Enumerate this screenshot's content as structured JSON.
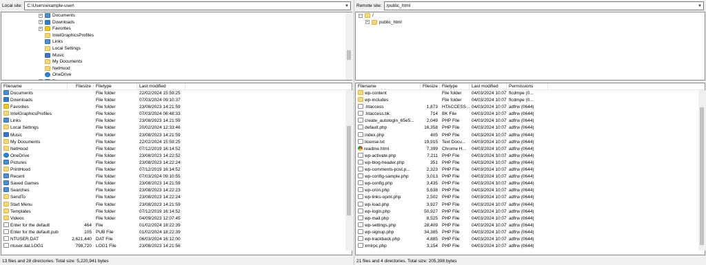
{
  "local": {
    "site_label": "Local site:",
    "path": "C:\\Users\\example-user\\",
    "tree": [
      {
        "label": "Documents",
        "indent": 1,
        "icon": "special",
        "exp": "+"
      },
      {
        "label": "Downloads",
        "indent": 1,
        "icon": "download",
        "exp": "+"
      },
      {
        "label": "Favorites",
        "indent": 1,
        "icon": "star",
        "exp": "+"
      },
      {
        "label": "IntelGraphicsProfiles",
        "indent": 1,
        "icon": "folder",
        "exp": ""
      },
      {
        "label": "Links",
        "indent": 1,
        "icon": "special",
        "exp": ""
      },
      {
        "label": "Local Settings",
        "indent": 1,
        "icon": "folder",
        "exp": ""
      },
      {
        "label": "Music",
        "indent": 1,
        "icon": "music",
        "exp": ""
      },
      {
        "label": "My Documents",
        "indent": 1,
        "icon": "folder",
        "exp": ""
      },
      {
        "label": "NetHood",
        "indent": 1,
        "icon": "folder",
        "exp": ""
      },
      {
        "label": "OneDrive",
        "indent": 1,
        "icon": "cloud",
        "exp": ""
      },
      {
        "label": "Pictures",
        "indent": 1,
        "icon": "special",
        "exp": "+"
      }
    ],
    "columns": [
      "Filename",
      "Filesize",
      "Filetype",
      "Last modified"
    ],
    "files": [
      {
        "name": "Documents",
        "size": "",
        "type": "File folder",
        "date": "22/02/2024 15:59:25",
        "icon": "special"
      },
      {
        "name": "Downloads",
        "size": "",
        "type": "File folder",
        "date": "07/03/2024 09:10:37",
        "icon": "download"
      },
      {
        "name": "Favorites",
        "size": "",
        "type": "File folder",
        "date": "23/08/2023 14:21:59",
        "icon": "star"
      },
      {
        "name": "IntelGraphicsProfiles",
        "size": "",
        "type": "File folder",
        "date": "07/03/2024 06:48:33",
        "icon": "folder"
      },
      {
        "name": "Links",
        "size": "",
        "type": "File folder",
        "date": "23/08/2023 14:21:59",
        "icon": "special"
      },
      {
        "name": "Local Settings",
        "size": "",
        "type": "File folder",
        "date": "20/02/2024 12:33:46",
        "icon": "folder"
      },
      {
        "name": "Music",
        "size": "",
        "type": "File folder",
        "date": "23/08/2023 14:21:59",
        "icon": "music"
      },
      {
        "name": "My Documents",
        "size": "",
        "type": "File folder",
        "date": "22/02/2024 15:59:25",
        "icon": "folder"
      },
      {
        "name": "NetHood",
        "size": "",
        "type": "File folder",
        "date": "07/12/2019 16:14:52",
        "icon": "folder"
      },
      {
        "name": "OneDrive",
        "size": "",
        "type": "File folder",
        "date": "23/08/2023 14:22:52",
        "icon": "cloud"
      },
      {
        "name": "Pictures",
        "size": "",
        "type": "File folder",
        "date": "23/08/2023 14:22:24",
        "icon": "special"
      },
      {
        "name": "PrintHood",
        "size": "",
        "type": "File folder",
        "date": "07/12/2019 16:14:52",
        "icon": "folder"
      },
      {
        "name": "Recent",
        "size": "",
        "type": "File folder",
        "date": "07/03/2024 09:10:55",
        "icon": "special"
      },
      {
        "name": "Saved Games",
        "size": "",
        "type": "File folder",
        "date": "23/08/2023 14:21:59",
        "icon": "special"
      },
      {
        "name": "Searches",
        "size": "",
        "type": "File folder",
        "date": "23/08/2023 14:22:23",
        "icon": "special"
      },
      {
        "name": "SendTo",
        "size": "",
        "type": "File folder",
        "date": "23/08/2023 14:22:24",
        "icon": "folder"
      },
      {
        "name": "Start Menu",
        "size": "",
        "type": "File folder",
        "date": "23/08/2023 14:21:59",
        "icon": "folder"
      },
      {
        "name": "Templates",
        "size": "",
        "type": "File folder",
        "date": "07/12/2019 16:14:52",
        "icon": "folder"
      },
      {
        "name": "Videos",
        "size": "",
        "type": "File folder",
        "date": "04/09/2023 12:07:45",
        "icon": "folder"
      },
      {
        "name": "Enter for the default",
        "size": "464",
        "type": "File",
        "date": "01/02/2024 18:22:39",
        "icon": "file"
      },
      {
        "name": "Enter for the default.pub",
        "size": "105",
        "type": "PUB File",
        "date": "01/02/2024 18:22:39",
        "icon": "file"
      },
      {
        "name": "NTUSER.DAT",
        "size": "2,621,440",
        "type": "DAT File",
        "date": "06/03/2024 16:12:00",
        "icon": "file"
      },
      {
        "name": "ntuser.dat.LOG1",
        "size": "798,720",
        "type": "LOG1 File",
        "date": "23/08/2023 14:21:56",
        "icon": "file"
      }
    ],
    "status": "13 files and 28 directories. Total size: 5,220,941 bytes"
  },
  "remote": {
    "site_label": "Remote site:",
    "path": "/public_html",
    "tree": [
      {
        "label": "/",
        "indent": 0,
        "icon": "folder",
        "exp": "-"
      },
      {
        "label": "public_html",
        "indent": 1,
        "icon": "folder",
        "exp": "+"
      }
    ],
    "columns": [
      "Filename",
      "Filesize",
      "Filetype",
      "Last modified",
      "Permissions"
    ],
    "files": [
      {
        "name": "wp-content",
        "size": "",
        "type": "File folder",
        "date": "04/03/2024 10:07:...",
        "perm": "flcdmpe (0...",
        "icon": "folder"
      },
      {
        "name": "wp-includes",
        "size": "",
        "type": "File folder",
        "date": "04/03/2024 10:07:...",
        "perm": "flcdmpe (0...",
        "icon": "folder"
      },
      {
        "name": ".htaccess",
        "size": "1,873",
        "type": "HTACCESS ...",
        "date": "04/03/2024 10:07:...",
        "perm": "adfrw (0644)",
        "icon": "file"
      },
      {
        "name": ".htaccess.bk",
        "size": "714",
        "type": "BK File",
        "date": "04/03/2024 10:07:...",
        "perm": "adfrw (0644)",
        "icon": "file"
      },
      {
        "name": "create_autologin_65e5...",
        "size": "2,049",
        "type": "PHP File",
        "date": "04/03/2024 10:07:...",
        "perm": "adfrw (0644)",
        "icon": "file"
      },
      {
        "name": "default.php",
        "size": "16,358",
        "type": "PHP File",
        "date": "04/03/2024 10:07:...",
        "perm": "adfrw (0644)",
        "icon": "file"
      },
      {
        "name": "index.php",
        "size": "405",
        "type": "PHP File",
        "date": "04/03/2024 10:07:...",
        "perm": "adfrw (0644)",
        "icon": "file"
      },
      {
        "name": "license.txt",
        "size": "19,915",
        "type": "Text Docu...",
        "date": "04/03/2024 10:07:...",
        "perm": "adfrw (0644)",
        "icon": "file"
      },
      {
        "name": "readme.html",
        "size": "7,399",
        "type": "Chrome H...",
        "date": "04/03/2024 10:07:...",
        "perm": "adfrw (0644)",
        "icon": "chrome"
      },
      {
        "name": "wp-activate.php",
        "size": "7,211",
        "type": "PHP File",
        "date": "04/03/2024 10:07:...",
        "perm": "adfrw (0644)",
        "icon": "file"
      },
      {
        "name": "wp-blog-header.php",
        "size": "351",
        "type": "PHP File",
        "date": "04/03/2024 10:07:...",
        "perm": "adfrw (0644)",
        "icon": "file"
      },
      {
        "name": "wp-comments-post.p...",
        "size": "2,323",
        "type": "PHP File",
        "date": "04/03/2024 10:07:...",
        "perm": "adfrw (0644)",
        "icon": "file"
      },
      {
        "name": "wp-config-sample.php",
        "size": "3,013",
        "type": "PHP File",
        "date": "04/03/2024 10:07:...",
        "perm": "adfrw (0644)",
        "icon": "file"
      },
      {
        "name": "wp-config.php",
        "size": "3,435",
        "type": "PHP File",
        "date": "04/03/2024 10:07:...",
        "perm": "adfrw (0644)",
        "icon": "file"
      },
      {
        "name": "wp-cron.php",
        "size": "5,638",
        "type": "PHP File",
        "date": "04/03/2024 10:07:...",
        "perm": "adfrw (0644)",
        "icon": "file"
      },
      {
        "name": "wp-links-opml.php",
        "size": "2,502",
        "type": "PHP File",
        "date": "04/03/2024 10:07:...",
        "perm": "adfrw (0644)",
        "icon": "file"
      },
      {
        "name": "wp-load.php",
        "size": "3,927",
        "type": "PHP File",
        "date": "04/03/2024 10:07:...",
        "perm": "adfrw (0644)",
        "icon": "file"
      },
      {
        "name": "wp-login.php",
        "size": "50,927",
        "type": "PHP File",
        "date": "04/03/2024 10:07:...",
        "perm": "adfrw (0644)",
        "icon": "file"
      },
      {
        "name": "wp-mail.php",
        "size": "8,525",
        "type": "PHP File",
        "date": "04/03/2024 10:07:...",
        "perm": "adfrw (0644)",
        "icon": "file"
      },
      {
        "name": "wp-settings.php",
        "size": "28,409",
        "type": "PHP File",
        "date": "04/03/2024 10:07:...",
        "perm": "adfrw (0644)",
        "icon": "file"
      },
      {
        "name": "wp-signup.php",
        "size": "34,385",
        "type": "PHP File",
        "date": "04/03/2024 10:07:...",
        "perm": "adfrw (0644)",
        "icon": "file"
      },
      {
        "name": "wp-trackback.php",
        "size": "4,885",
        "type": "PHP File",
        "date": "04/03/2024 10:07:...",
        "perm": "adfrw (0644)",
        "icon": "file"
      },
      {
        "name": "xmlrpc.php",
        "size": "3,154",
        "type": "PHP File",
        "date": "04/03/2024 10:07:...",
        "perm": "adfrw (0644)",
        "icon": "file"
      }
    ],
    "status": "21 files and 4 directories. Total size: 205,398 bytes"
  }
}
